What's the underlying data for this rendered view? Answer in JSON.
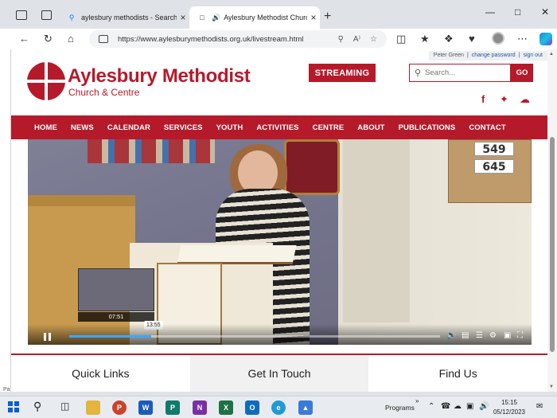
{
  "browser": {
    "tabs": [
      {
        "label": "aylesbury methodists - Search",
        "favicon": "search-icon"
      },
      {
        "label": "Aylesbury Methodist Church & Centre",
        "favicon": "page-icon",
        "audio": "speaker-icon"
      }
    ],
    "new_tab": "+",
    "url": "https://www.aylesburymethodists.org.uk/livestream.html"
  },
  "site": {
    "user": {
      "name": "Peter Green",
      "sep": "|",
      "change_password": "change password",
      "sign_out": "sign out"
    },
    "brand": {
      "title": "Aylesbury Methodist",
      "subtitle": "Church & Centre"
    },
    "streaming_label": "STREAMING",
    "search": {
      "placeholder": "Search...",
      "go": "GO"
    },
    "social": {
      "facebook": "f",
      "twitter": "t",
      "cloud": "cloud-icon"
    },
    "nav": [
      "HOME",
      "NEWS",
      "CALENDAR",
      "SERVICES",
      "YOUTH",
      "ACTIVITIES",
      "CENTRE",
      "ABOUT",
      "PUBLICATIONS",
      "CONTACT"
    ],
    "video": {
      "hymn_numbers": [
        "549",
        "645"
      ],
      "preview_time": "07:51",
      "hover_time": "13:55",
      "progress": 0.22
    },
    "footer_columns": [
      "Quick Links",
      "Get In Touch",
      "Find Us"
    ]
  },
  "statusbar": {
    "left": "Pa"
  },
  "taskbar": {
    "programs_label": "Programs",
    "time": "15:15",
    "date": "05/12/2023"
  },
  "colors": {
    "brand_red": "#b51a2b",
    "progress_blue": "#3ea6ff"
  }
}
